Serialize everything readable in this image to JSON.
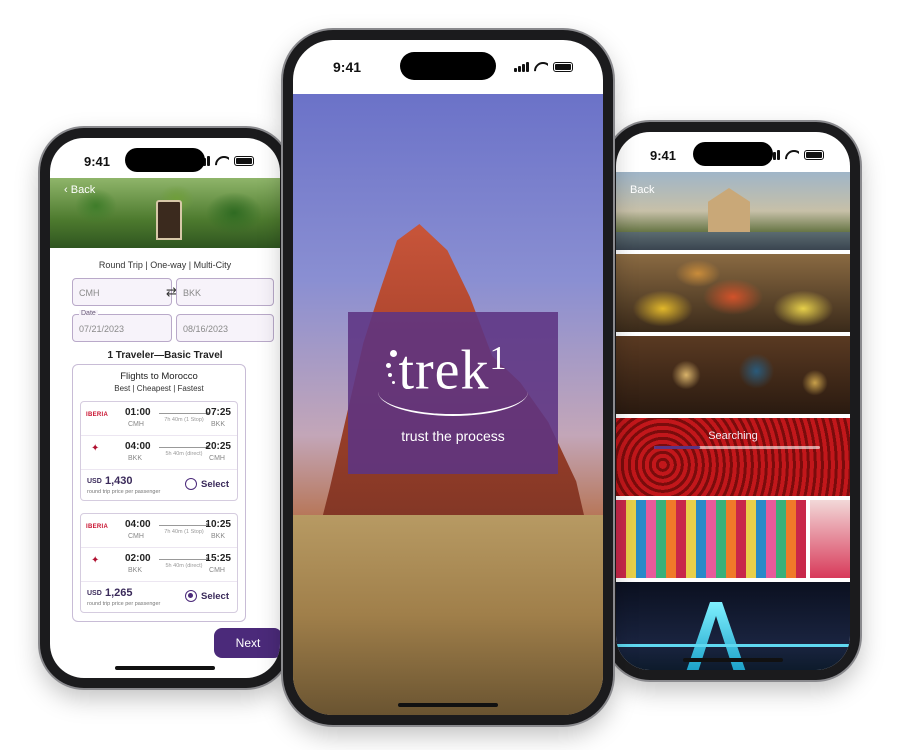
{
  "left_phone": {
    "time": "9:41",
    "back_label": "Back",
    "trip_type": "Round Trip | One-way | Multi-City",
    "origin": "CMH",
    "destination": "BKK",
    "date_label": "Date",
    "depart_date": "07/21/2023",
    "return_date": "08/16/2023",
    "travelers": "1 Traveler—Basic Travel",
    "results_title": "Flights to Morocco",
    "results_sort": "Best | Cheapest | Fastest",
    "flights": [
      {
        "legs": [
          {
            "airline": "IBERIA",
            "dep": "01:00",
            "arr": "07:25",
            "from": "CMH",
            "to": "BKK",
            "duration": "7h 40m (1 Stop)"
          },
          {
            "airline": "RAM",
            "dep": "04:00",
            "arr": "20:25",
            "from": "BKK",
            "to": "CMH",
            "duration": "5h 40m (direct)"
          }
        ],
        "currency": "USD",
        "price": "1,430",
        "price_note": "round trip price per passenger",
        "select_label": "Select",
        "selected": false
      },
      {
        "legs": [
          {
            "airline": "IBERIA",
            "dep": "04:00",
            "arr": "10:25",
            "from": "CMH",
            "to": "BKK",
            "duration": "7h 40m (1 Stop)"
          },
          {
            "airline": "RAM",
            "dep": "02:00",
            "arr": "15:25",
            "from": "BKK",
            "to": "CMH",
            "duration": "5h 40m (direct)"
          }
        ],
        "currency": "USD",
        "price": "1,265",
        "price_note": "round trip price per passenger",
        "select_label": "Select",
        "selected": true
      }
    ],
    "next_label": "Next"
  },
  "center_phone": {
    "time": "9:41",
    "logo_text": "trek",
    "logo_number": "1",
    "tagline": "trust the process"
  },
  "right_phone": {
    "time": "9:41",
    "back_label": "Back",
    "searching_label": "Searching",
    "search_progress": 0.28
  },
  "colors": {
    "brand_purple": "#4b2a7a",
    "logo_overlay": "#5d3483",
    "iberia_red": "#c8102e"
  }
}
